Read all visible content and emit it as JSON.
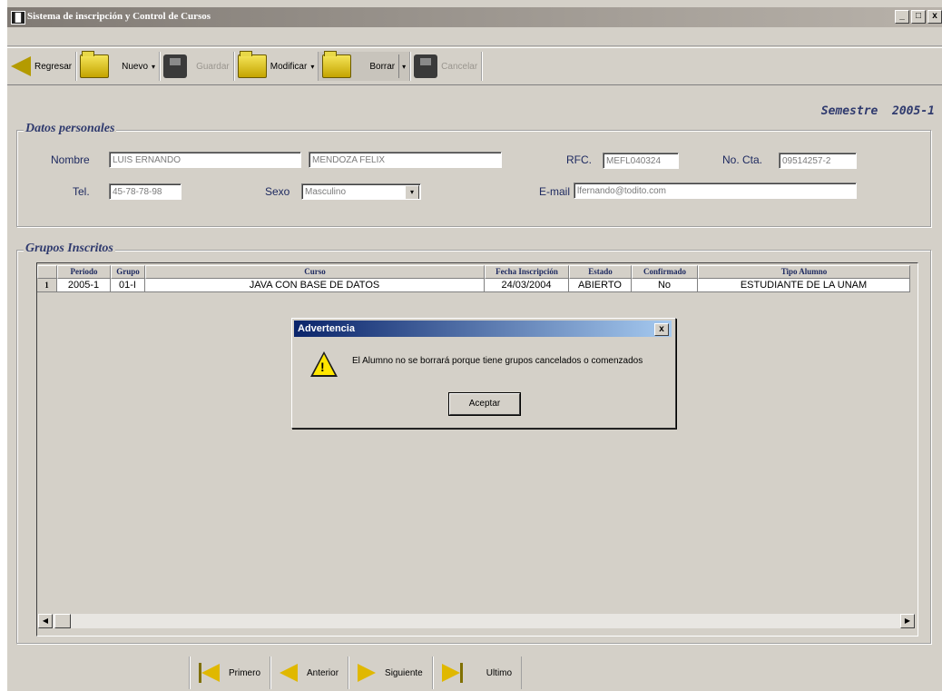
{
  "window": {
    "title": "Sistema de inscripción y Control de Cursos",
    "min_label": "_",
    "max_label": "□",
    "close_label": "x"
  },
  "toolbar": {
    "regresar": "Regresar",
    "nuevo": "Nuevo",
    "guardar": "Guardar",
    "modificar": "Modificar",
    "borrar": "Borrar",
    "cancelar": "Cancelar",
    "dropdown_glyph": "▾"
  },
  "semestre": {
    "label": "Semestre",
    "value": "2005-1"
  },
  "datos": {
    "title": "Datos personales",
    "nombre_label": "Nombre",
    "nombre": "LUIS ERNANDO",
    "apellidos": "MENDOZA FELIX",
    "rfc_label": "RFC.",
    "rfc": "MEFL040324",
    "cta_label": "No. Cta.",
    "cta": "09514257-2",
    "tel_label": "Tel.",
    "tel": "45-78-78-98",
    "sexo_label": "Sexo",
    "sexo": "Masculino",
    "email_label": "E-mail",
    "email": "lfernando@todito.com"
  },
  "grupos": {
    "title": "Grupos Inscritos",
    "columns": [
      "Periodo",
      "Grupo",
      "Curso",
      "Fecha Inscripción",
      "Estado",
      "Confirmado",
      "Tipo Alumno"
    ],
    "rows": [
      {
        "n": "1",
        "periodo": "2005-1",
        "grupo": "01-I",
        "curso": "JAVA CON BASE DE DATOS",
        "fecha": "24/03/2004",
        "estado": "ABIERTO",
        "confirmado": "No",
        "tipo": "ESTUDIANTE DE LA UNAM"
      }
    ]
  },
  "nav": {
    "primero": "Primero",
    "anterior": "Anterior",
    "siguiente": "Siguiente",
    "ultimo": "Ultimo"
  },
  "dialog": {
    "title": "Advertencia",
    "close": "x",
    "message": "El Alumno no se borrará porque tiene grupos cancelados o comenzados",
    "button": "Aceptar"
  },
  "colors": {
    "accent": "#2f3a6e",
    "dialog_title": "#0a246a",
    "warn": "#ffe600"
  }
}
